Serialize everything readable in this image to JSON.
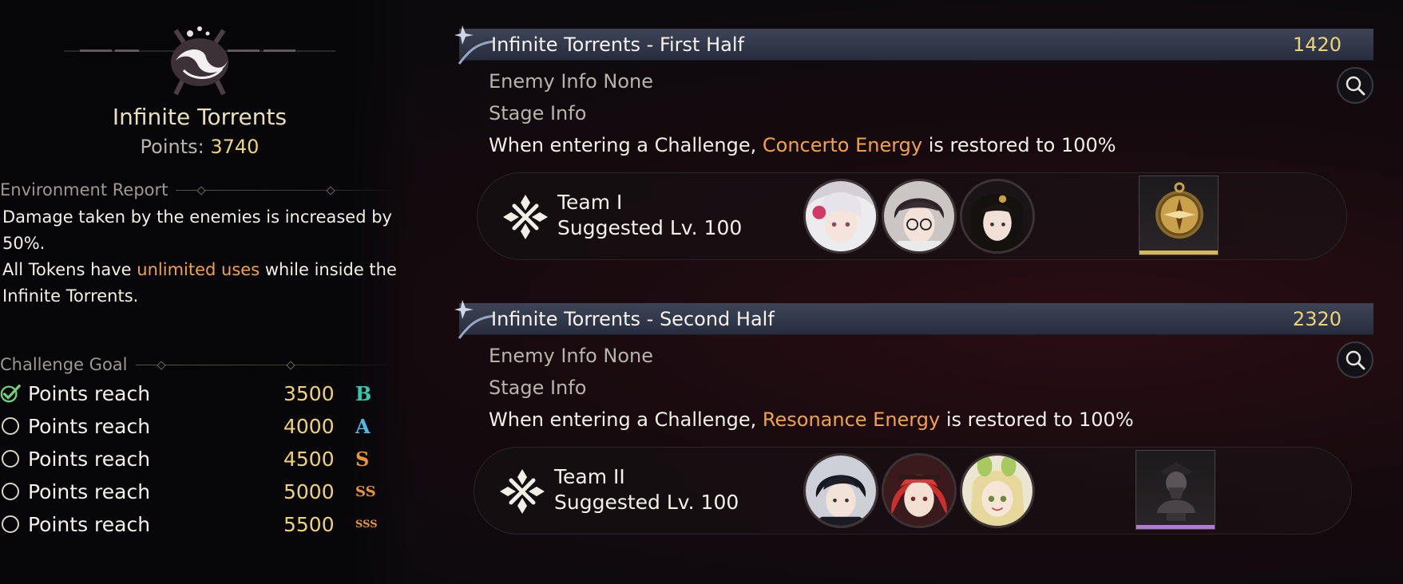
{
  "stage": {
    "title": "Infinite Torrents",
    "points_label": "Points: ",
    "points_value": "3740"
  },
  "environment": {
    "heading": "Environment Report",
    "line1": "Damage taken by the enemies is increased by 50%.",
    "line2_before": "All Tokens have ",
    "line2_highlight": "unlimited uses",
    "line2_after": " while inside the Infinite Torrents."
  },
  "goals": {
    "heading": "Challenge Goal",
    "rows": [
      {
        "label": "Points reach",
        "value": "3500",
        "rank": "B",
        "done": true
      },
      {
        "label": "Points reach",
        "value": "4000",
        "rank": "A",
        "done": false
      },
      {
        "label": "Points reach",
        "value": "4500",
        "rank": "S",
        "done": false
      },
      {
        "label": "Points reach",
        "value": "5000",
        "rank": "SS",
        "done": false
      },
      {
        "label": "Points reach",
        "value": "5500",
        "rank": "SSS",
        "done": false
      }
    ]
  },
  "halves": [
    {
      "title": "Infinite Torrents - First Half",
      "score": "1420",
      "enemy_info": "Enemy Info  None",
      "stage_info": "Stage Info",
      "desc_before": "When entering a Challenge, ",
      "desc_highlight": "Concerto Energy",
      "desc_after": " is restored to 100%",
      "team_name": "Team I",
      "suggested": "Suggested Lv. 100"
    },
    {
      "title": "Infinite Torrents - Second Half",
      "score": "2320",
      "enemy_info": "Enemy Info  None",
      "stage_info": "Stage Info",
      "desc_before": "When entering a Challenge, ",
      "desc_highlight": "Resonance Energy",
      "desc_after": " is restored to 100%",
      "team_name": "Team II",
      "suggested": "Suggested Lv. 100"
    }
  ],
  "colors": {
    "accent_gold": "#f0d276",
    "highlight_orange": "#f3a345",
    "check_green": "#6fd07a",
    "rank_B": "#35c9b0",
    "rank_A": "#4fb8e8",
    "rank_S": "#e8943a"
  },
  "icons": {
    "emblem": "torrent-emblem",
    "team": "crossed-swords-icon",
    "search": "magnifier-icon",
    "item1": "compass-item",
    "item2": "bust-statue-item"
  }
}
